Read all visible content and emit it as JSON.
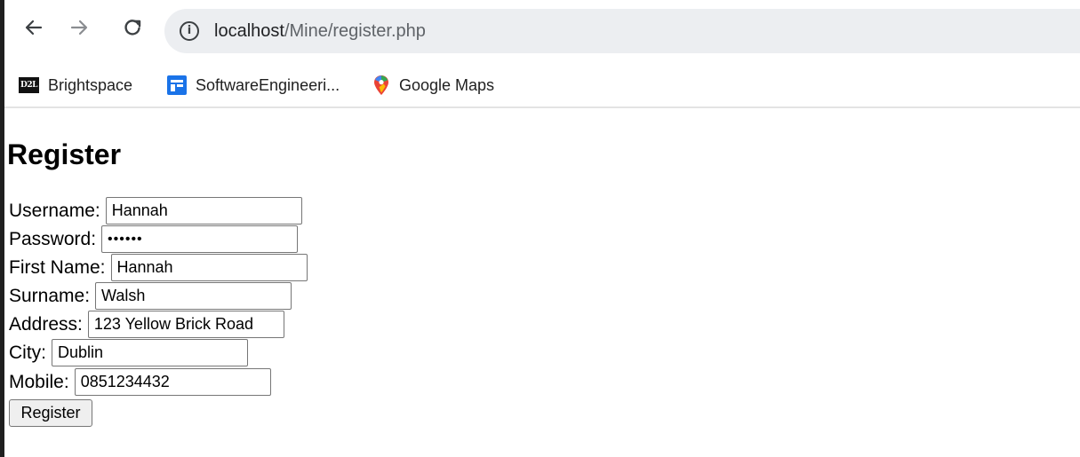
{
  "browser": {
    "url_host": "localhost",
    "url_path": "/Mine/register.php",
    "site_info_glyph": "i",
    "icons": {
      "back": "back-arrow-icon",
      "forward": "forward-arrow-icon",
      "reload": "reload-icon",
      "site_info": "info-circle-icon"
    }
  },
  "bookmarks": [
    {
      "label": "Brightspace",
      "icon": "d2l-logo-icon",
      "icon_text": "D2L"
    },
    {
      "label": "SoftwareEngineeri...",
      "icon": "google-forms-icon"
    },
    {
      "label": "Google Maps",
      "icon": "google-maps-icon"
    }
  ],
  "page": {
    "title": "Register",
    "fields": {
      "username": {
        "label": "Username:",
        "value": "Hannah"
      },
      "password": {
        "label": "Password:",
        "value": "••••••"
      },
      "first_name": {
        "label": "First Name:",
        "value": "Hannah"
      },
      "surname": {
        "label": "Surname:",
        "value": "Walsh"
      },
      "address": {
        "label": "Address:",
        "value": "123 Yellow Brick Road"
      },
      "city": {
        "label": "City:",
        "value": "Dublin"
      },
      "mobile": {
        "label": "Mobile:",
        "value": "0851234432"
      }
    },
    "submit_label": "Register"
  },
  "colors": {
    "omnibox_background": "#eceef1",
    "forms_icon_blue": "#1a73e8",
    "maps_pin_red": "#ea4335",
    "button_background": "#efefef"
  }
}
